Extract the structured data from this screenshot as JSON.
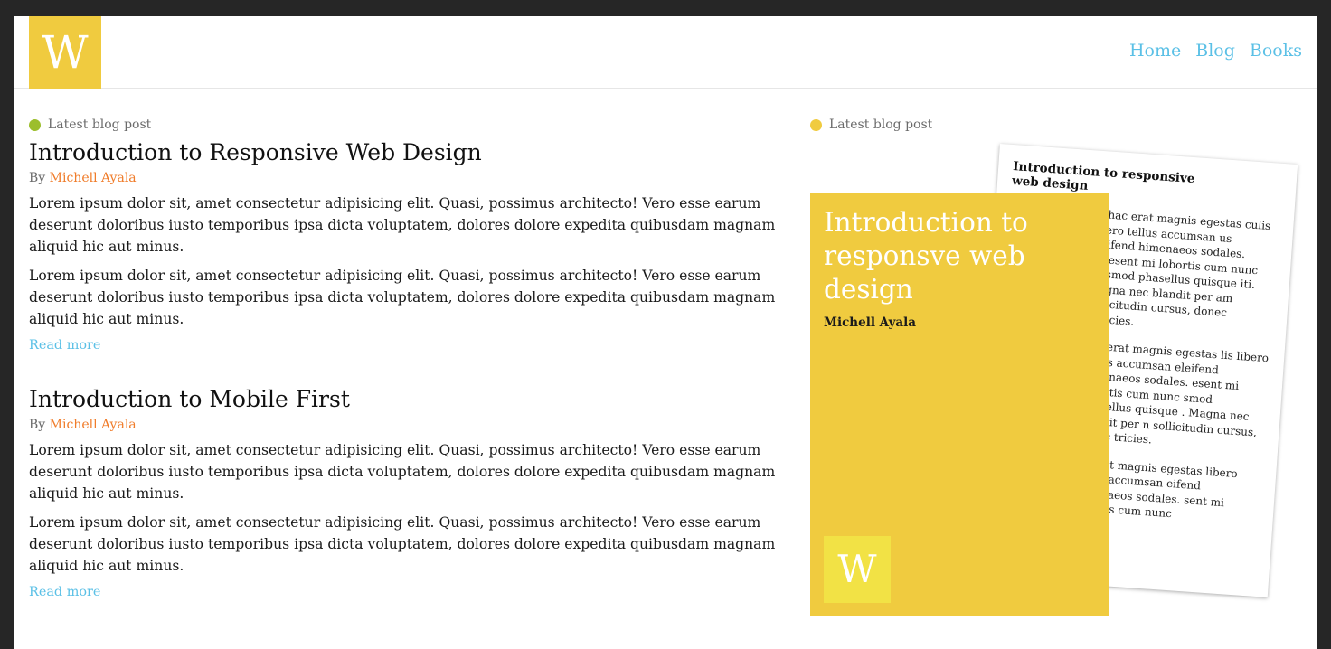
{
  "brand": {
    "logo_letter": "W"
  },
  "nav": {
    "home": "Home",
    "blog": "Blog",
    "books": "Books"
  },
  "posts": [
    {
      "eyebrow": "Latest blog post",
      "title": "Introduction to Responsive Web Design",
      "by": "By",
      "author": "Michell Ayala",
      "paragraphs": [
        "Lorem ipsum dolor sit, amet consectetur adipisicing elit. Quasi, possimus architecto! Vero esse earum deserunt doloribus iusto temporibus ipsa dicta voluptatem, dolores dolore expedita quibusdam magnam aliquid hic aut minus.",
        "Lorem ipsum dolor sit, amet consectetur adipisicing elit. Quasi, possimus architecto! Vero esse earum deserunt doloribus iusto temporibus ipsa dicta voluptatem, dolores dolore expedita quibusdam magnam aliquid hic aut minus."
      ],
      "read_more": "Read more"
    },
    {
      "title": "Introduction to Mobile First",
      "by": "By",
      "author": "Michell Ayala",
      "paragraphs": [
        "Lorem ipsum dolor sit, amet consectetur adipisicing elit. Quasi, possimus architecto! Vero esse earum deserunt doloribus iusto temporibus ipsa dicta voluptatem, dolores dolore expedita quibusdam magnam aliquid hic aut minus.",
        "Lorem ipsum dolor sit, amet consectetur adipisicing elit. Quasi, possimus architecto! Vero esse earum deserunt doloribus iusto temporibus ipsa dicta voluptatem, dolores dolore expedita quibusdam magnam aliquid hic aut minus."
      ],
      "read_more": "Read more"
    }
  ],
  "aside": {
    "eyebrow": "Latest blog post",
    "paper_title": "Introduction to responsive web design",
    "paper_paragraphs": [
      "or hac erat magnis egestas culis libero tellus accumsan us eleifend himenaeos sodales. praesent mi lobortis cum nunc euismod phasellus quisque iti. Magna nec blandit per am sollicitudin cursus, donec ultricies.",
      "hac erat magnis egestas lis libero tellus accumsan eleifend himenaeos sodales. esent mi lobortis cum nunc smod phasellus quisque . Magna nec blandit per n sollicitudin cursus, donec tricies.",
      "ac erat magnis egestas libero tellus accumsan eifend himenaeos sodales. sent mi lobortis cum nunc"
    ],
    "cover_title": "Introduction to responsve web design",
    "cover_author": "Michell Ayala",
    "cover_logo_letter": "W"
  },
  "colors": {
    "accent_yellow": "#f0cb3f",
    "link_blue": "#5bc0e6",
    "author_orange": "#f07c2a",
    "dot_green": "#9cbe2c",
    "dot_yellow": "#f0cb3f",
    "frame": "#262626"
  }
}
